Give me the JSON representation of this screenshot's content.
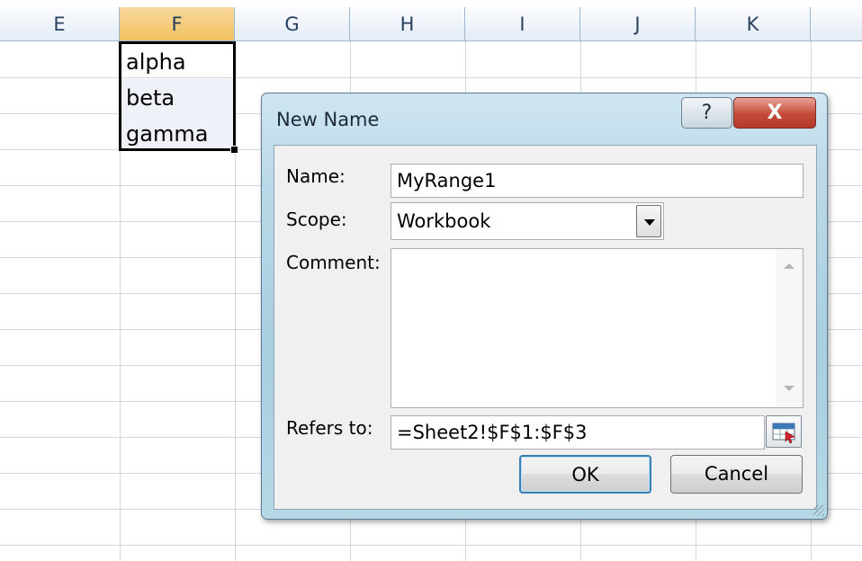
{
  "sheet": {
    "columns": [
      "E",
      "F",
      "G",
      "H",
      "I",
      "J",
      "K"
    ],
    "active_column": "F",
    "cells": [
      "alpha",
      "beta",
      "gamma"
    ]
  },
  "dialog": {
    "title": "New Name",
    "help_glyph": "?",
    "close_glyph": "X",
    "name_label": "Name:",
    "name_value": "MyRange1",
    "scope_label": "Scope:",
    "scope_value": "Workbook",
    "comment_label": "Comment:",
    "comment_value": "",
    "refers_label": "Refers to:",
    "refers_value": "=Sheet2!$F$1:$F$3",
    "ok_label": "OK",
    "cancel_label": "Cancel"
  },
  "icons": {
    "dropdown": "chevron-down-icon",
    "range_picker": "range-select-icon",
    "help": "help-icon",
    "close": "close-icon"
  },
  "colors": {
    "active_column_header": "#f1c15f",
    "close_button": "#c44a38",
    "ok_border": "#3c7fb1"
  }
}
